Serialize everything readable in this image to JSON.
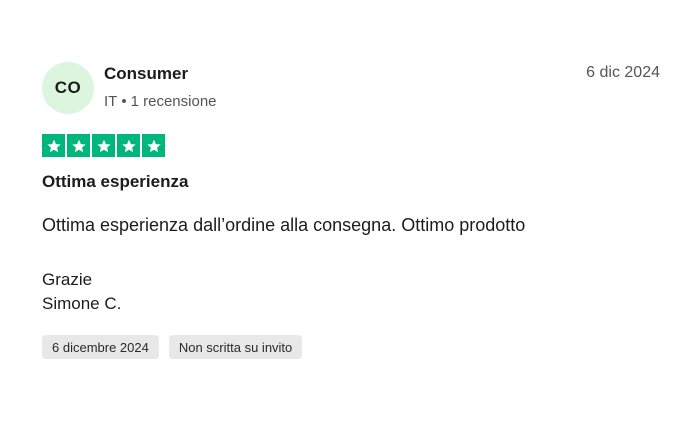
{
  "author": {
    "initials": "CO",
    "name": "Consumer",
    "country": "IT",
    "separator": "•",
    "reviews_count": "1 recensione"
  },
  "review": {
    "date_short": "6 dic 2024",
    "rating": 5,
    "rating_max": 5,
    "star_color": "#00b67a",
    "star_icon": "star-icon",
    "title": "Ottima esperienza",
    "body": "Ottima esperienza dall’ordine alla consegna. Ottimo prodotto",
    "closing_line_1": "Grazie",
    "closing_line_2": "Simone C."
  },
  "tags": {
    "experience_date": "6 dicembre 2024",
    "invitation_status": "Non scritta su invito"
  },
  "colors": {
    "avatar_bg": "#dcf5dd",
    "tag_bg": "#e8e8e8"
  }
}
